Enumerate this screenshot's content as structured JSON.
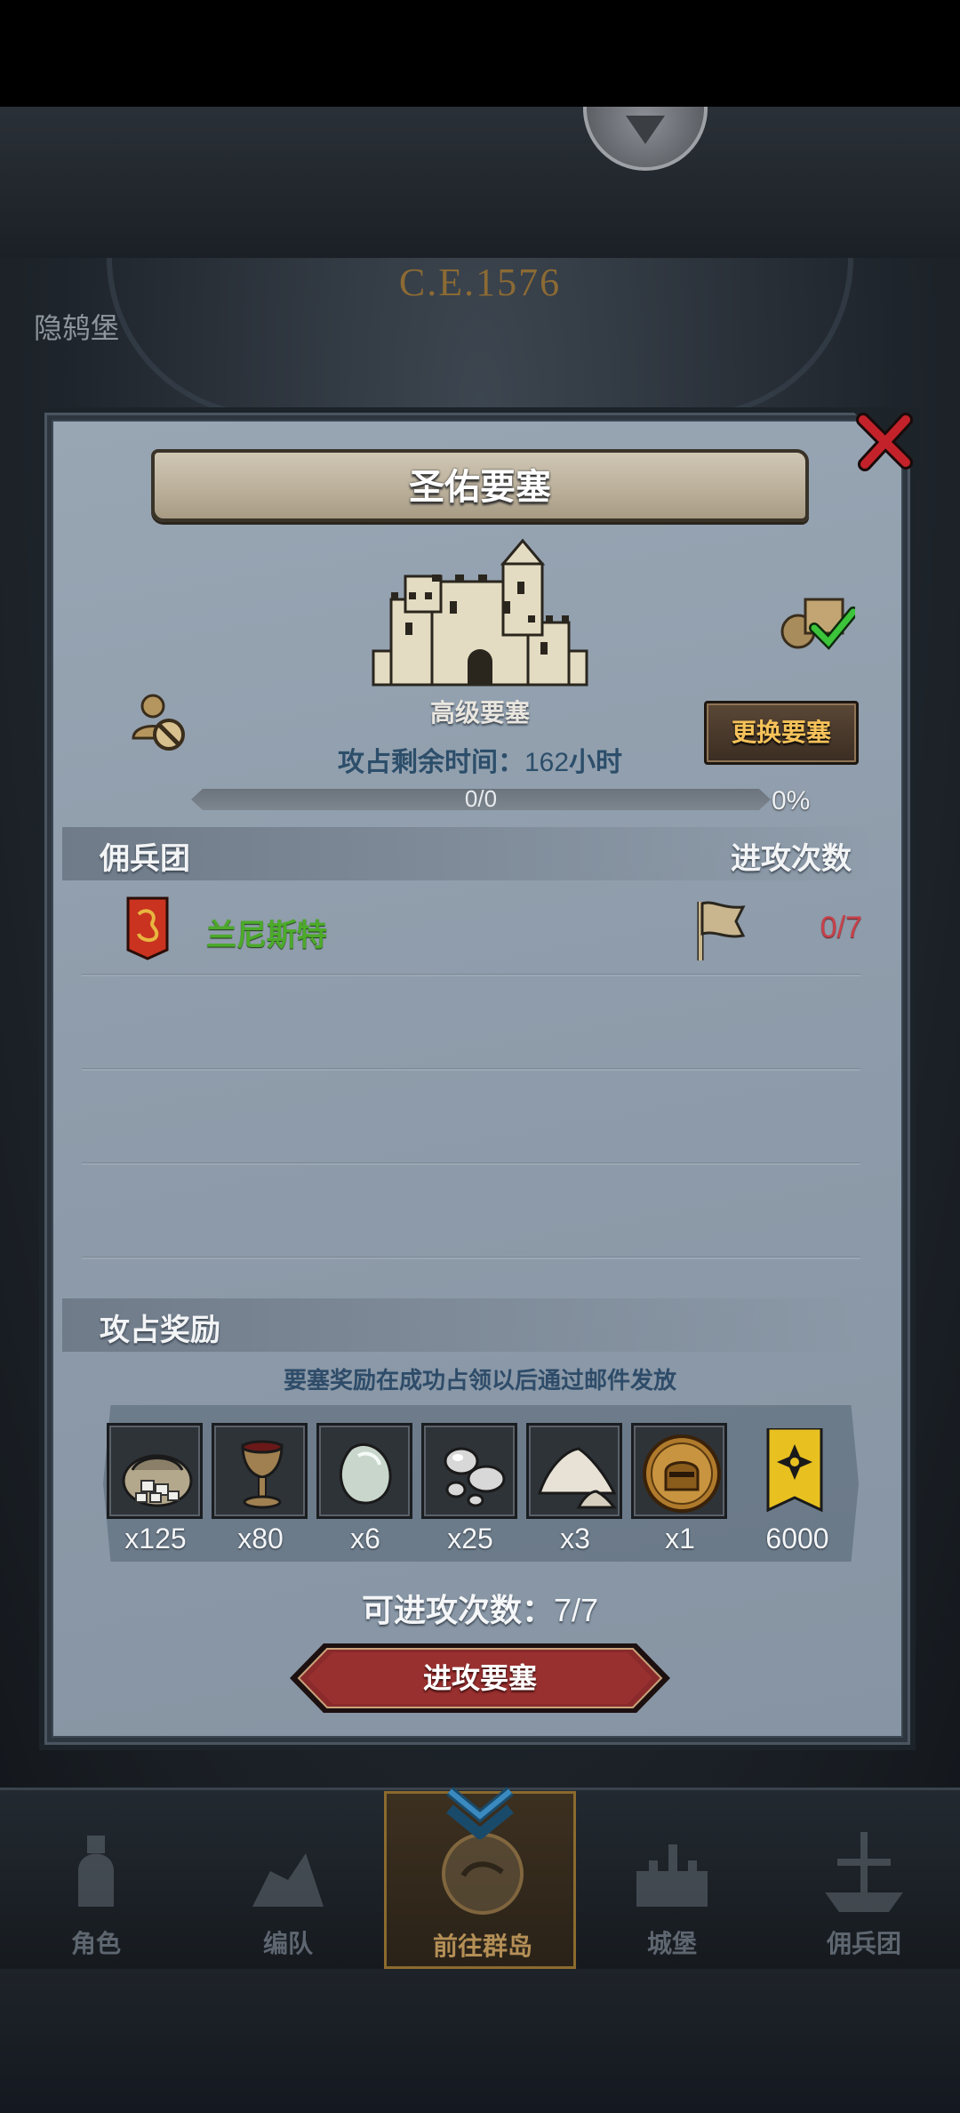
{
  "background": {
    "date": "C.E.1576",
    "town_label": "隐鸫堡"
  },
  "modal": {
    "title": "圣佑要塞",
    "fortress_type": "高级要塞",
    "change_button": "更换要塞",
    "timer_label": "攻占剩余时间：",
    "timer_value": "162",
    "timer_unit": "小时",
    "progress_text": "0/0",
    "progress_fraction": 0,
    "progress_percent": "0%",
    "mercenary_section": {
      "left_title": "佣兵团",
      "right_title": "进攻次数",
      "rows": [
        {
          "name": "兰尼斯特",
          "attacks": "0/7"
        }
      ]
    },
    "reward_section": {
      "title": "攻占奖励",
      "note": "要塞奖励在成功占领以后通过邮件发放",
      "items": [
        {
          "icon": "silver-ore-sack-icon",
          "qty": "x125"
        },
        {
          "icon": "goblet-icon",
          "qty": "x80"
        },
        {
          "icon": "gemstone-icon",
          "qty": "x6"
        },
        {
          "icon": "silver-nuggets-icon",
          "qty": "x25"
        },
        {
          "icon": "salt-pile-icon",
          "qty": "x3"
        },
        {
          "icon": "knight-helmet-medal-icon",
          "qty": "x1"
        },
        {
          "icon": "gold-banner-icon",
          "qty": "6000"
        }
      ]
    },
    "remaining_label": "可进攻次数：",
    "remaining_value": "7/7",
    "attack_button": "进攻要塞"
  },
  "nav": {
    "items": [
      {
        "label": "角色",
        "icon": "knight-icon"
      },
      {
        "label": "编队",
        "icon": "formation-icon"
      },
      {
        "label": "前往群岛",
        "icon": "map-compass-icon"
      },
      {
        "label": "城堡",
        "icon": "castle-icon"
      },
      {
        "label": "佣兵团",
        "icon": "ship-icon"
      }
    ],
    "active_index": 2
  }
}
